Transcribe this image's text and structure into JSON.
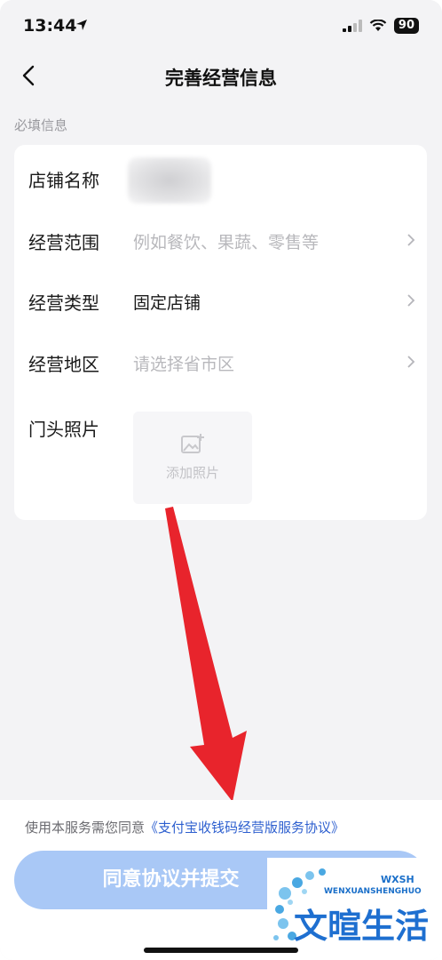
{
  "status_bar": {
    "time": "13:44",
    "battery": "90"
  },
  "nav": {
    "title": "完善经营信息",
    "back_icon": "chevron-left-icon"
  },
  "section_label": "必填信息",
  "form": {
    "store_name": {
      "label": "店铺名称",
      "value": ""
    },
    "business_scope": {
      "label": "经营范围",
      "placeholder": "例如餐饮、果蔬、零售等"
    },
    "business_type": {
      "label": "经营类型",
      "value": "固定店铺"
    },
    "business_region": {
      "label": "经营地区",
      "placeholder": "请选择省市区"
    },
    "storefront_photo": {
      "label": "门头照片",
      "button_text": "添加照片"
    }
  },
  "footer": {
    "agreement_prefix": "使用本服务需您同意",
    "agreement_link": "《支付宝收钱码经营版服务协议》",
    "submit_label": "同意协议并提交"
  },
  "watermark": {
    "brand_cn": "文暄生活",
    "brand_pinyin": "WENXUANSHENGHUO",
    "brand_abbr": "WXSH"
  },
  "colors": {
    "accent_link": "#2d5fcf",
    "button_disabled": "#a9c8f6",
    "annotation_arrow": "#e8242c"
  }
}
